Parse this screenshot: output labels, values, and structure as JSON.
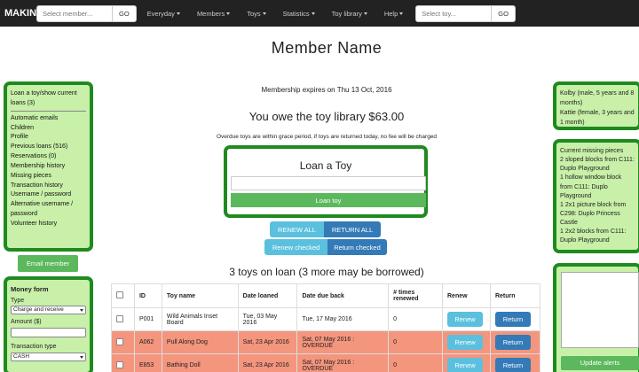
{
  "navbar": {
    "brand": "MAKIN",
    "member_search": {
      "placeholder": "Select member...",
      "go_label": "GO"
    },
    "menu": [
      {
        "label": "Everyday"
      },
      {
        "label": "Members"
      },
      {
        "label": "Toys"
      },
      {
        "label": "Statistics"
      },
      {
        "label": "Toy library"
      },
      {
        "label": "Help"
      }
    ],
    "toy_search": {
      "placeholder": "Select toy...",
      "go_label": "GO"
    }
  },
  "left_nav": {
    "items": [
      {
        "label": "Loan a toy/show current loans (3)",
        "active": true
      },
      {
        "label": "Automatic emails"
      },
      {
        "label": "Children"
      },
      {
        "label": "Profile"
      },
      {
        "label": "Previous loans (516)"
      },
      {
        "label": "Reservations (0)"
      },
      {
        "label": "Membership history"
      },
      {
        "label": "Missing pieces"
      },
      {
        "label": "Transaction history"
      },
      {
        "label": "Username / password"
      },
      {
        "label": "Alternative username / password"
      },
      {
        "label": "Volunteer history"
      }
    ],
    "email_button": "Email member"
  },
  "money_form": {
    "title": "Money form",
    "type_label": "Type",
    "type_value": "Charge and receive",
    "amount_label": "Amount ($)",
    "transaction_type_label": "Transaction type",
    "transaction_type_value": "CASH"
  },
  "main": {
    "title": "Member Name",
    "membership_expires": "Membership expires on Thu 13 Oct, 2016",
    "owe": "You owe the toy library $63.00",
    "overdue_note": "Overdue toys are within grace period, if toys are returned today, no fee will be charged",
    "loan_title": "Loan a Toy",
    "loan_button": "Loan toy",
    "renew_all": "RENEW ALL",
    "return_all": "RETURN ALL",
    "renew_checked": "Renew checked",
    "return_checked": "Return checked",
    "on_loan": "3 toys on loan (3 more may be borrowed)"
  },
  "loans_table": {
    "headers": [
      "ID",
      "Toy name",
      "Date loaned",
      "Date due back",
      "# times renewed",
      "Renew",
      "Return"
    ],
    "rows": [
      {
        "id": "P001",
        "name": "Wild Animals Inset Board",
        "loaned": "Tue, 03 May 2016",
        "due": "Tue, 17 May 2016",
        "renewed": "0",
        "overdue": false,
        "renew": "Renew",
        "return": "Return"
      },
      {
        "id": "A062",
        "name": "Pull Along Dog",
        "loaned": "Sat, 23 Apr 2016",
        "due": "Sat, 07 May 2016 : OVERDUE",
        "renewed": "0",
        "overdue": true,
        "renew": "Renew",
        "return": "Return"
      },
      {
        "id": "E853",
        "name": "Bathing Doll",
        "loaned": "Sat, 23 Apr 2016",
        "due": "Sat, 07 May 2016 : OVERDUE",
        "renewed": "0",
        "overdue": true,
        "renew": "Renew",
        "return": "Return"
      }
    ]
  },
  "right_panel": {
    "children": "Kolby (male, 5 years and 8 months)",
    "children2": "Kattie (female, 3 years and 1 month)",
    "missing_title": "Current missing pieces",
    "missing": [
      {
        "desc": "2 sloped blocks from",
        "toy": "C111: Duplo Playground"
      },
      {
        "desc": "1 hollow window block from",
        "toy": "C111: Duplo Playground"
      },
      {
        "desc": "1 2x1 picture block from",
        "toy": "C298: Duplo Princess Castle"
      },
      {
        "desc": "1 2x2 blocks from",
        "toy": "C111: Duplo Playground"
      }
    ],
    "update_button": "Update alerts"
  },
  "colors": {
    "navbar": "#222222",
    "panel_bg": "#c8f0a8",
    "panel_border": "#1f8a1f",
    "success": "#5cb85c",
    "info": "#5bc0de",
    "primary": "#337ab7",
    "overdue_row": "#f4957d"
  }
}
